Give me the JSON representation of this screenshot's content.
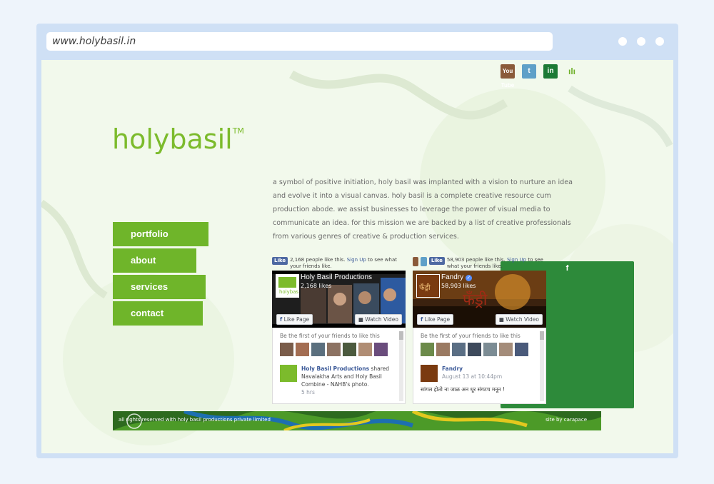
{
  "browser": {
    "url": "www.holybasil.in"
  },
  "social_icons": [
    {
      "name": "facebook-icon",
      "glyph": "f"
    },
    {
      "name": "youtube-icon",
      "glyph": "You Tube"
    },
    {
      "name": "twitter-icon",
      "glyph": "t"
    },
    {
      "name": "linkedin-icon",
      "glyph": "in"
    },
    {
      "name": "equalizer-icon",
      "glyph": "ılı"
    }
  ],
  "logo": {
    "text": "holybasil",
    "tm": "TM"
  },
  "menu": [
    "portfolio",
    "about",
    "services",
    "contact"
  ],
  "intro": "a symbol of positive initiation, holy basil was implanted with a vision to nurture an idea and evolve it into a visual canvas. holy basil is a complete creative resource cum production abode. we assist businesses to leverage the power of visual media to communicate an idea. for this mission we are backed by a list of creative professionals from various genres of creative & production services.",
  "widget1": {
    "like_label": "Like",
    "top_text": "2,168 people like this.",
    "signup": "Sign Up",
    "top_text2": "to see what your friends like.",
    "page_name": "Holy Basil Productions",
    "likes": "2,168 likes",
    "like_page": "Like Page",
    "watch_video": "Watch Video",
    "first_friends": "Be the first of your friends to like this",
    "post_name": "Holy Basil Productions",
    "post_text": "shared Navalakha Arts and Holy Basil Combine - NAHB's photo.",
    "post_time": "5 hrs"
  },
  "widget2": {
    "like_label": "Like",
    "top_text": "58,903 people like this.",
    "signup": "Sign Up",
    "top_text2": "to see what your friends like.",
    "page_name": "Fandry",
    "likes": "58,903 likes",
    "like_page": "Like Page",
    "watch_video": "Watch Video",
    "first_friends": "Be the first of your friends to like this",
    "post_name": "Fandry",
    "post_time": "August 13 at 10:44pm",
    "post_text": "सांगल होतो ना जाळ अन धूर संगटच मनून !"
  },
  "footer": {
    "rights": "all rights reserved with holy basil productions private limited",
    "credit": "site by carapace"
  },
  "colors": {
    "brand_green": "#6fb52a",
    "logo_green": "#7cbb2c",
    "fb_blue": "#3b5998"
  }
}
